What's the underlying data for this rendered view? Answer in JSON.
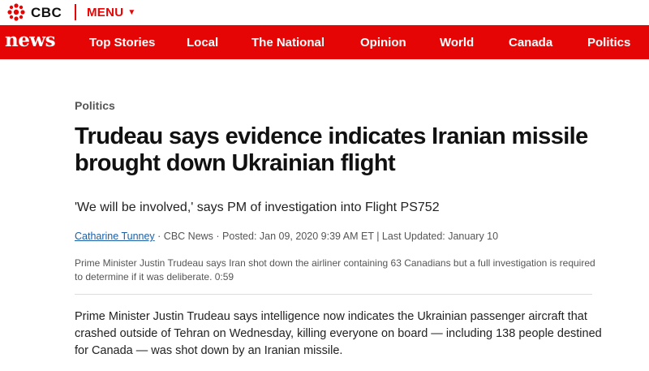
{
  "header": {
    "brand": "CBC",
    "menu_label": "MENU",
    "menu_chevron": "chevron-down-icon",
    "accent_color": "#e60505"
  },
  "nav": {
    "logo": "news",
    "items": [
      {
        "label": "Top Stories"
      },
      {
        "label": "Local"
      },
      {
        "label": "The National"
      },
      {
        "label": "Opinion"
      },
      {
        "label": "World"
      },
      {
        "label": "Canada"
      },
      {
        "label": "Politics"
      }
    ]
  },
  "article": {
    "section": "Politics",
    "headline": "Trudeau says evidence indicates Iranian missile brought down Ukrainian flight",
    "deck": "'We will be involved,' says PM of investigation into Flight PS752",
    "author": "Catharine Tunney",
    "byline_meta": "· CBC News · Posted: Jan 09, 2020 9:39 AM ET | Last Updated: January 10",
    "caption": "Prime Minister Justin Trudeau says Iran shot down the airliner containing 63 Canadians but a full investigation is required to determine if it was deliberate. 0:59",
    "lead": "Prime Minister Justin Trudeau says intelligence now indicates the Ukrainian passenger aircraft that crashed outside of Tehran on Wednesday, killing everyone on board — including 138 people destined for Canada — was shot down by an Iranian missile."
  }
}
